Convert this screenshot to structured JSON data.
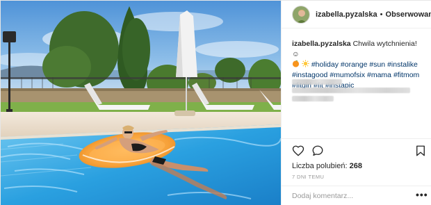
{
  "colors": {
    "text": "#262626",
    "hashtag": "#003569",
    "muted": "#999999",
    "border": "#efefef"
  },
  "header": {
    "username": "izabella.pyzalska",
    "separator": "•",
    "follow_label": "Obserwowanie"
  },
  "caption": {
    "username": "izabella.pyzalska",
    "text": "Chwila wytchnienia!",
    "smile_emoji": "☺",
    "emojis": [
      "orange-emoji",
      "sun-emoji"
    ],
    "hashtags": [
      "#holiday",
      "#orange",
      "#sun",
      "#instalike",
      "#instagood",
      "#mumofsix",
      "#mama",
      "#fitmom",
      "#fitgirl",
      "#fit",
      "#instapic"
    ]
  },
  "actions": {
    "icons": [
      "heart-icon",
      "comment-icon",
      "bookmark-icon"
    ]
  },
  "likes": {
    "label": "Liczba polubień:",
    "count": "268"
  },
  "timestamp": "7 DNI TEMU",
  "comment": {
    "placeholder": "Dodaj komentarz...",
    "more_label": "•••"
  }
}
